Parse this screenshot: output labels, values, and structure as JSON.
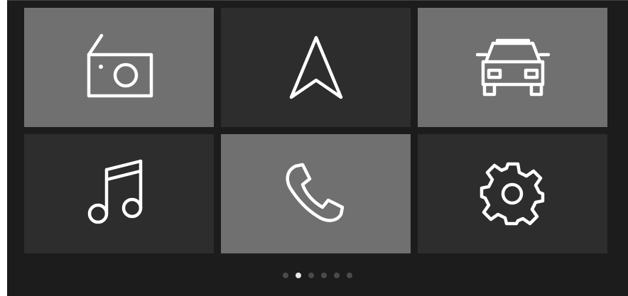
{
  "tiles": [
    {
      "name": "radio",
      "icon": "radio-icon",
      "state": "highlighted"
    },
    {
      "name": "navigation",
      "icon": "navigation-arrow-icon",
      "state": "normal"
    },
    {
      "name": "vehicle",
      "icon": "car-icon",
      "state": "highlighted"
    },
    {
      "name": "music",
      "icon": "music-note-icon",
      "state": "normal"
    },
    {
      "name": "phone",
      "icon": "phone-icon",
      "state": "highlighted"
    },
    {
      "name": "settings",
      "icon": "gear-icon",
      "state": "normal"
    }
  ],
  "pagination": {
    "total_pages": 6,
    "current_page": 2
  },
  "colors": {
    "background": "#1c1c1c",
    "tile_highlighted": "#707070",
    "tile_normal": "#2d2d2d",
    "icon_stroke": "#ffffff",
    "dot_inactive": "#4a4a4a",
    "dot_active": "#e8e8e8"
  }
}
